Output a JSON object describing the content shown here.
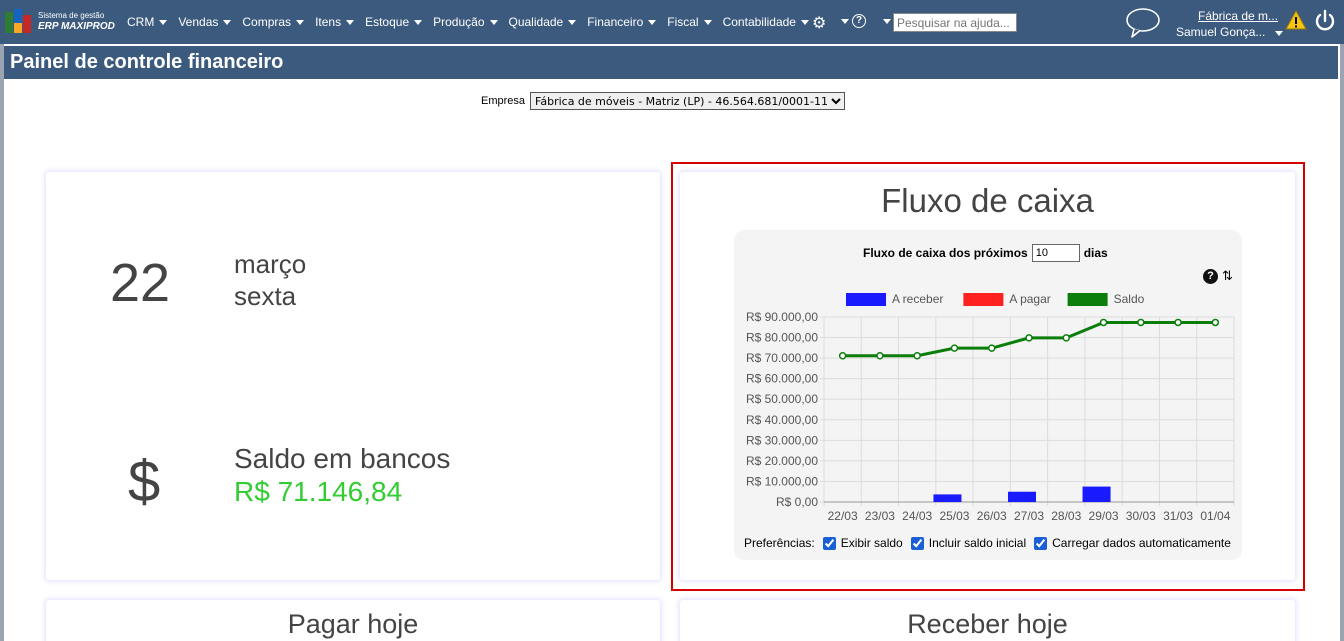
{
  "app": {
    "logo_line1": "Sistema de gestão",
    "logo_line2": "ERP MAXIPROD"
  },
  "menu": [
    {
      "label": "CRM"
    },
    {
      "label": "Vendas"
    },
    {
      "label": "Compras"
    },
    {
      "label": "Itens"
    },
    {
      "label": "Estoque"
    },
    {
      "label": "Produção"
    },
    {
      "label": "Qualidade"
    },
    {
      "label": "Financeiro"
    },
    {
      "label": "Fiscal"
    },
    {
      "label": "Contabilidade"
    }
  ],
  "search": {
    "placeholder": "Pesquisar na ajuda..."
  },
  "user": {
    "company": "Fábrica de m...",
    "name": "Samuel Gonça..."
  },
  "page": {
    "title": "Painel de controle financeiro"
  },
  "company_selector": {
    "label": "Empresa",
    "selected": "Fábrica de móveis - Matriz (LP) - 46.564.681/0001-11"
  },
  "date_card": {
    "day": "22",
    "month": "março",
    "weekday": "sexta"
  },
  "balance_card": {
    "symbol": "$",
    "label": "Saldo em bancos",
    "value": "R$ 71.146,84"
  },
  "cash_flow": {
    "title": "Fluxo de caixa",
    "days_prefix": "Fluxo de caixa dos próximos",
    "days_value": "10",
    "days_suffix": "dias",
    "help": "?",
    "prefs_label": "Preferências:",
    "pref_show_balance": "Exibir saldo",
    "pref_include_initial": "Incluir saldo inicial",
    "pref_autoload": "Carregar dados automaticamente"
  },
  "bottom": {
    "pay_today": "Pagar hoje",
    "receive_today": "Receber hoje"
  },
  "chart_data": {
    "type": "bar",
    "categories": [
      "22/03",
      "23/03",
      "24/03",
      "25/03",
      "26/03",
      "27/03",
      "28/03",
      "29/03",
      "30/03",
      "31/03",
      "01/04"
    ],
    "series": [
      {
        "name": "A receber",
        "type": "bar",
        "color": "#1a1aff",
        "values": [
          0,
          0,
          0,
          3700,
          0,
          5000,
          0,
          7500,
          0,
          0,
          0
        ]
      },
      {
        "name": "A pagar",
        "type": "bar",
        "color": "#ff2020",
        "values": [
          0,
          0,
          0,
          0,
          0,
          0,
          0,
          0,
          0,
          0,
          0
        ]
      },
      {
        "name": "Saldo",
        "type": "line",
        "color": "#0a7d0a",
        "values": [
          71146.84,
          71146.84,
          71146.84,
          74846.84,
          74846.84,
          79846.84,
          79846.84,
          87346.84,
          87346.84,
          87346.84,
          87346.84
        ]
      }
    ],
    "ytick_labels": [
      "R$ 0,00",
      "R$ 10.000,00",
      "R$ 20.000,00",
      "R$ 30.000,00",
      "R$ 40.000,00",
      "R$ 50.000,00",
      "R$ 60.000,00",
      "R$ 70.000,00",
      "R$ 80.000,00",
      "R$ 90.000,00"
    ],
    "ylim": [
      0,
      90000
    ],
    "grid": true,
    "legend_position": "top"
  }
}
